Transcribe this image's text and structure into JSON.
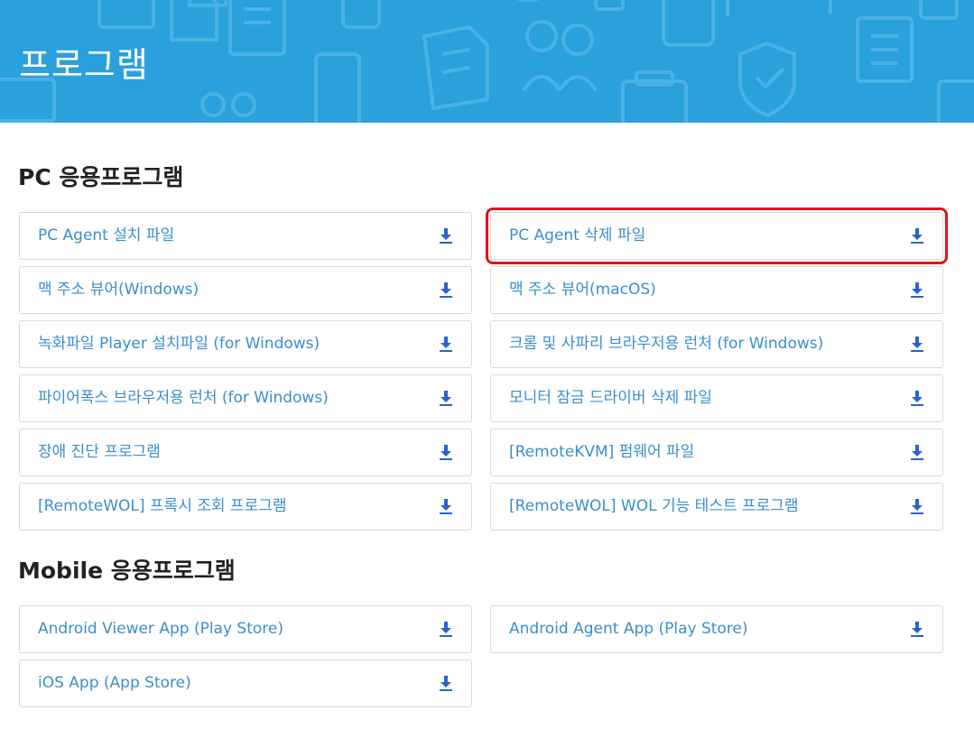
{
  "banner": {
    "title": "프로그램",
    "color": "#2aa0dc"
  },
  "sections": [
    {
      "title": "PC 응용프로그램",
      "items": [
        {
          "label": "PC Agent 설치 파일",
          "icon": "download-icon"
        },
        {
          "label": "PC Agent 삭제 파일",
          "icon": "download-icon",
          "highlighted": true
        },
        {
          "label": "맥 주소 뷰어(Windows)",
          "icon": "download-icon"
        },
        {
          "label": "맥 주소 뷰어(macOS)",
          "icon": "download-icon"
        },
        {
          "label": "녹화파일 Player 설치파일 (for Windows)",
          "icon": "download-icon"
        },
        {
          "label": "크롬 및 사파리 브라우저용 런처 (for Windows)",
          "icon": "download-icon"
        },
        {
          "label": "파이어폭스 브라우저용 런처 (for Windows)",
          "icon": "download-icon"
        },
        {
          "label": "모니터 잠금 드라이버 삭제 파일",
          "icon": "download-icon"
        },
        {
          "label": "장애 진단 프로그램",
          "icon": "download-icon"
        },
        {
          "label": "[RemoteKVM] 펌웨어 파일",
          "icon": "download-icon"
        },
        {
          "label": "[RemoteWOL] 프록시 조회 프로그램",
          "icon": "download-icon"
        },
        {
          "label": "[RemoteWOL] WOL 기능 테스트 프로그램",
          "icon": "download-icon"
        }
      ]
    },
    {
      "title": "Mobile 응용프로그램",
      "items": [
        {
          "label": "Android Viewer App (Play Store)",
          "icon": "download-icon"
        },
        {
          "label": "Android Agent App (Play Store)",
          "icon": "download-icon"
        },
        {
          "label": "iOS App (App Store)",
          "icon": "download-icon"
        }
      ]
    }
  ],
  "colors": {
    "link": "#3a8fc9",
    "icon": "#2a63c9",
    "highlight": "#e0131e"
  }
}
